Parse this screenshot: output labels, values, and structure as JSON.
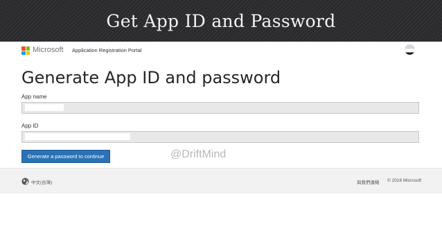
{
  "slide": {
    "title": "Get App ID and Password"
  },
  "header": {
    "brand": "Microsoft",
    "portal_link": "Application Registration Portal",
    "logo_colors": [
      "#f25022",
      "#7fba00",
      "#00a4ef",
      "#ffb900"
    ]
  },
  "main": {
    "heading": "Generate App ID and password",
    "app_name": {
      "label": "App name",
      "value": ""
    },
    "app_id": {
      "label": "App ID",
      "value": ""
    },
    "generate_button": "Generate a password to continue",
    "watermark": "@DriftMind"
  },
  "footer": {
    "language": "中文(台灣)",
    "contact": "與我們連絡",
    "copyright": "© 2016 Microsoft"
  },
  "colors": {
    "accent": "#2b72b5",
    "banner": "#2b2b2d",
    "footer": "#f2f2f2"
  },
  "icons": [
    "microsoft-logo-icon",
    "user-avatar-icon",
    "globe-icon"
  ]
}
